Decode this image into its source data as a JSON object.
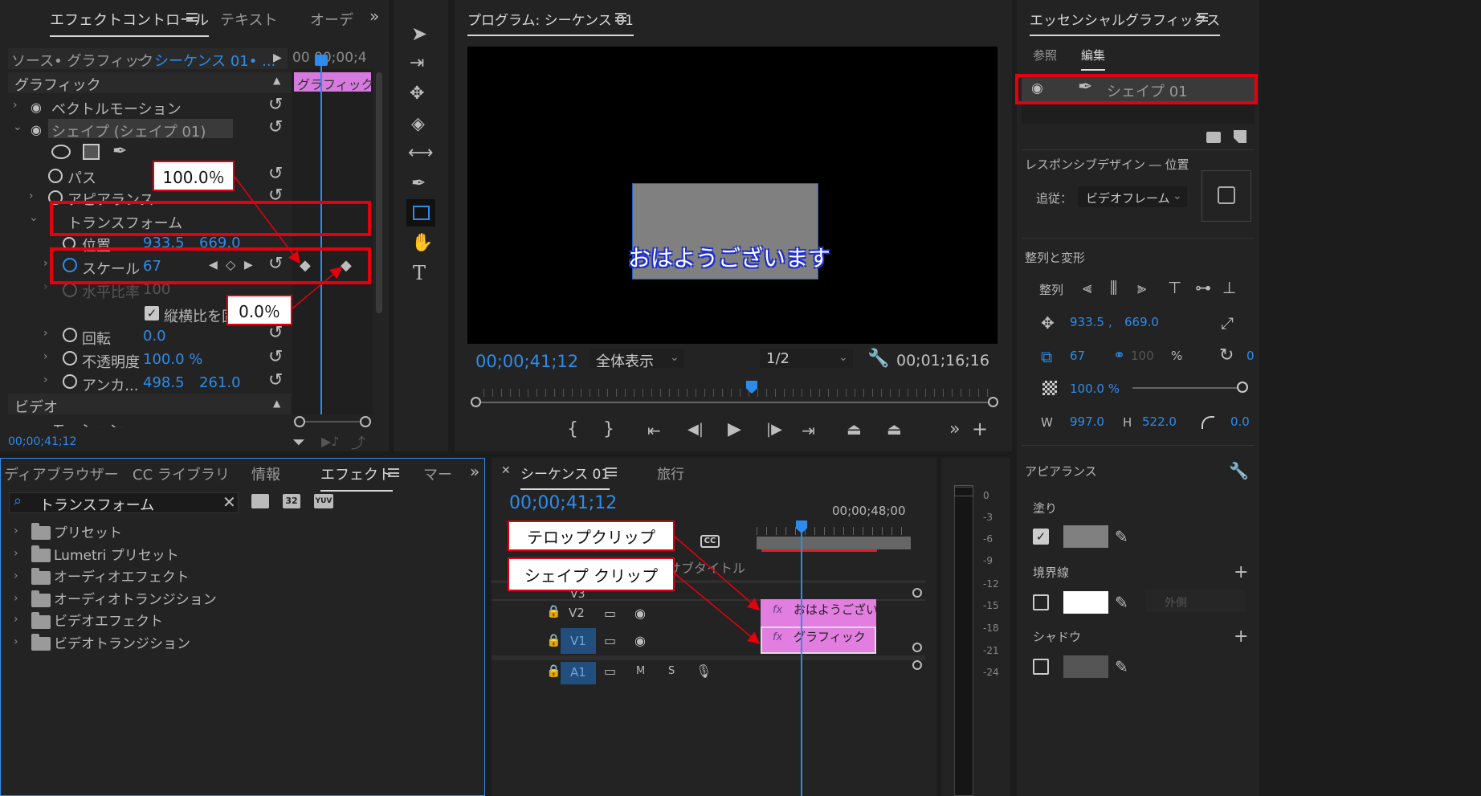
{
  "effect_controls": {
    "tabs": [
      "エフェクトコントロール",
      "テキスト",
      "オーデ"
    ],
    "source_label": "ソース• グラフィック",
    "sequence_label": "シーケンス 01• ...",
    "timecode_ruler": "00 00;00;4",
    "section_graphic": "グラフィック",
    "vector_motion": "ベクトルモーション",
    "shape_layer": "シェイプ (シェイプ 01)",
    "path": "パス",
    "appearance": "アピアランス",
    "transform": "トランスフォーム",
    "position_label": "位置",
    "position_x": "933.5",
    "position_y": "669.0",
    "scale_label": "スケール",
    "scale_value": "67",
    "scale_width_label": "水平比率",
    "scale_width_value": "100",
    "uniform_label": "縦横比を固定",
    "rotation_label": "回転",
    "rotation_value": "0.0",
    "opacity_label": "不透明度",
    "opacity_value": "100.0 %",
    "anchor_label": "アンカ...",
    "anchor_x": "498.5",
    "anchor_y": "261.0",
    "section_video": "ビデオ",
    "motion": "モーション",
    "clip_label": "グラフィック",
    "current_time": "00;00;41;12"
  },
  "callouts": {
    "pct100": "100.0％",
    "pct0": "0.0％",
    "telop_clip": "テロップクリップ",
    "shape_clip": "シェイプ クリップ"
  },
  "program": {
    "title": "プログラム: シーケンス 01",
    "overlay_text": "おはようございます",
    "timecode": "00;00;41;12",
    "fit": "全体表示",
    "resolution": "1/2",
    "duration": "00;01;16;16"
  },
  "project": {
    "tabs": [
      "ディアブラウザー",
      "CC ライブラリ",
      "情報",
      "エフェクト",
      "マー"
    ],
    "search_value": "トランスフォーム",
    "folders": [
      "プリセット",
      "Lumetri プリセット",
      "オーディオエフェクト",
      "オーディオトランジション",
      "ビデオエフェクト",
      "ビデオトランジション"
    ],
    "icon_labels": [
      "32",
      "YUV"
    ]
  },
  "timeline": {
    "tabs": [
      "シーケンス 01",
      "旅行"
    ],
    "timecode": "00;00;41;12",
    "ruler_time": "00;00;48;00",
    "cc_label": "CC",
    "subtitle_label": "サブタイトル",
    "tracks": [
      "V3",
      "V2",
      "V1",
      "A1"
    ],
    "clip_v2": "おはようござい",
    "clip_v1": "グラフィック",
    "fx_label": "fx",
    "m_label": "M",
    "s_label": "S"
  },
  "meter": {
    "labels": [
      "0",
      "-3",
      "-6",
      "-9",
      "-12",
      "-15",
      "-18",
      "-21",
      "-24"
    ]
  },
  "essential": {
    "title": "エッセンシャルグラフィックス",
    "tabs": [
      "参照",
      "編集"
    ],
    "layer_name": "シェイプ 01",
    "responsive_label": "レスポンシブデザイン ― 位置",
    "follow_label": "追従：",
    "follow_value": "ビデオフレーム",
    "align_label": "整列と変形",
    "align_row_label": "整列",
    "pos_x": "933.5",
    "pos_y": "669.0",
    "scale": "67",
    "scale_w": "100",
    "percent": "%",
    "rotation": "0",
    "opacity": "100.0 %",
    "w_label": "W",
    "w_value": "997.0",
    "h_label": "H",
    "h_value": "522.0",
    "radius": "0.0",
    "pos_sep": ",",
    "appearance_label": "アピアランス",
    "fill_label": "塗り",
    "stroke_label": "境界線",
    "stroke_type": "外側",
    "shadow_label": "シャドウ"
  },
  "colors": {
    "accent": "#2d8ceb",
    "callout_border": "#e3000f",
    "clip_pink": "#e37ce0",
    "shape_gray": "#808080"
  }
}
